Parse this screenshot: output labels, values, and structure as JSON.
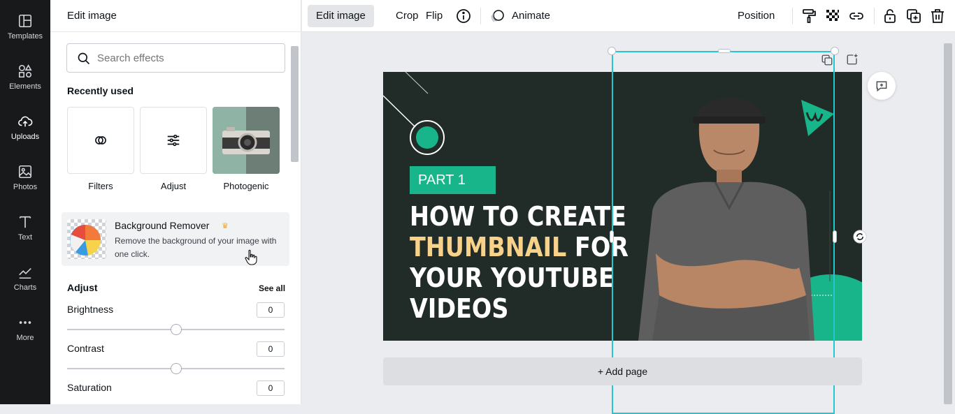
{
  "rail": {
    "items": [
      {
        "label": "Templates",
        "icon": "templates-icon"
      },
      {
        "label": "Elements",
        "icon": "elements-icon"
      },
      {
        "label": "Uploads",
        "icon": "cloud-upload-icon"
      },
      {
        "label": "Photos",
        "icon": "image-icon"
      },
      {
        "label": "Text",
        "icon": "text-icon"
      },
      {
        "label": "Charts",
        "icon": "chart-icon"
      },
      {
        "label": "More",
        "icon": "more-dots-icon"
      }
    ]
  },
  "panel": {
    "title": "Edit image",
    "search_placeholder": "Search effects",
    "recently_used_title": "Recently used",
    "tiles": [
      {
        "label": "Filters"
      },
      {
        "label": "Adjust"
      },
      {
        "label": "Photogenic"
      }
    ],
    "background_remover": {
      "title": "Background Remover",
      "description": "Remove the background of your image with one click."
    },
    "adjust": {
      "title": "Adjust",
      "see_all": "See all",
      "sliders": [
        {
          "label": "Brightness",
          "value": "0"
        },
        {
          "label": "Contrast",
          "value": "0"
        },
        {
          "label": "Saturation",
          "value": "0"
        }
      ]
    }
  },
  "toolbar": {
    "edit_image": "Edit image",
    "crop": "Crop",
    "flip": "Flip",
    "animate": "Animate",
    "position": "Position"
  },
  "design": {
    "part_label": "PART 1",
    "headline_line1": "HOW TO CREATE",
    "headline_accent": "THUMBNAIL",
    "headline_line2_rest": " FOR",
    "headline_line3": "YOUR YOUTUBE",
    "headline_line4": "VIDEOS"
  },
  "add_page": "+ Add page",
  "colors": {
    "canvas_bg": "#212b28",
    "accent_green": "#19b58a",
    "accent_yellow": "#f8d28a",
    "selection": "#21c8cf"
  }
}
